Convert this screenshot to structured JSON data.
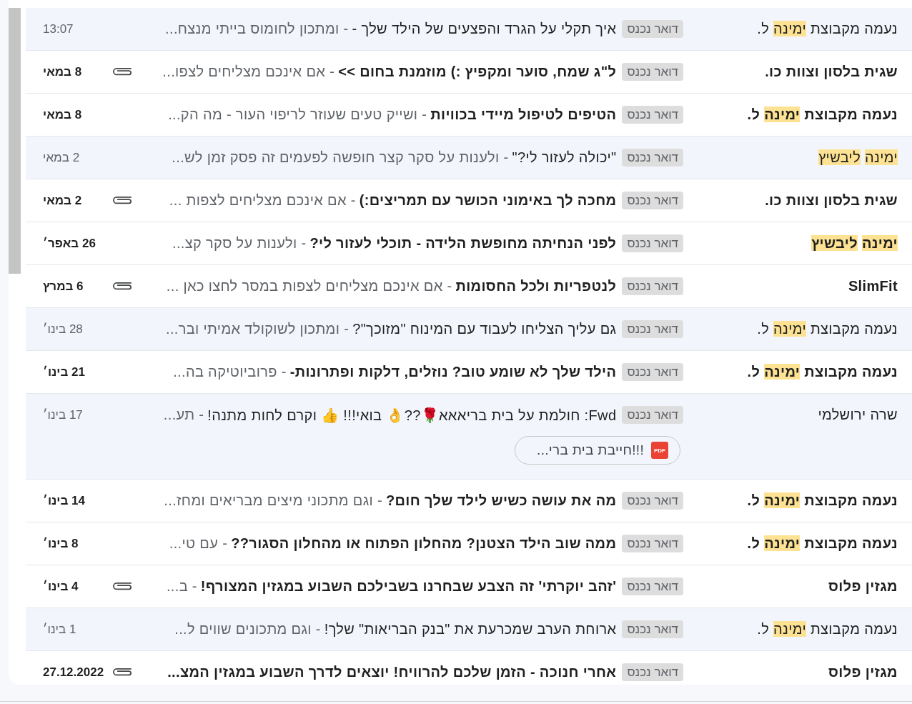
{
  "emails": [
    {
      "unread": false,
      "sender": [
        {
          "word": "נעמה",
          "highlighted": false
        },
        {
          "word": "מקבוצת",
          "highlighted": false
        },
        {
          "word": "ימינה",
          "highlighted": true
        },
        {
          "word": "ל.",
          "highlighted": false
        }
      ],
      "label": "דואר נכנס",
      "subject": "איך תקלי על הגרד והפצעים של הילד שלך -",
      "snippet": "- ומתכון לחומוס בייתי מנצח...",
      "attachment": false,
      "date": "13:07"
    },
    {
      "unread": true,
      "sender": [
        {
          "word": "שגית",
          "highlighted": false
        },
        {
          "word": "בלסון",
          "highlighted": false
        },
        {
          "word": "וצוות",
          "highlighted": false
        },
        {
          "word": "כו.",
          "highlighted": false
        }
      ],
      "label": "דואר נכנס",
      "subject": "ל\"ג שמח, סוער ומקפיץ :) מוזמנת בחום >>",
      "snippet": "- אם אינכם מצליחים לצפו...",
      "attachment": true,
      "date": "8 במאי"
    },
    {
      "unread": true,
      "sender": [
        {
          "word": "נעמה",
          "highlighted": false
        },
        {
          "word": "מקבוצת",
          "highlighted": false
        },
        {
          "word": "ימינה",
          "highlighted": true
        },
        {
          "word": "ל.",
          "highlighted": false
        }
      ],
      "label": "דואר נכנס",
      "subject": "הטיפים לטיפול מיידי בכוויות",
      "snippet": "- ושייק טעים שעוזר לריפוי העור - מה הק...",
      "attachment": false,
      "date": "8 במאי"
    },
    {
      "unread": false,
      "sender": [
        {
          "word": "ימינה",
          "highlighted": true
        },
        {
          "word": "ליבשיץ",
          "highlighted": true
        }
      ],
      "label": "דואר נכנס",
      "subject": "\"יכולה לעזור לי?\"",
      "snippet": "- ולענות על סקר קצר חופשה לפעמים זה פסק זמן לש...",
      "attachment": false,
      "date": "2 במאי"
    },
    {
      "unread": true,
      "sender": [
        {
          "word": "שגית",
          "highlighted": false
        },
        {
          "word": "בלסון",
          "highlighted": false
        },
        {
          "word": "וצוות",
          "highlighted": false
        },
        {
          "word": "כו.",
          "highlighted": false
        }
      ],
      "label": "דואר נכנס",
      "subject": "מחכה לך באימוני הכושר עם תמריצים:)",
      "snippet": "- אם אינכם מצליחים לצפות ...",
      "attachment": true,
      "date": "2 במאי"
    },
    {
      "unread": true,
      "sender": [
        {
          "word": "ימינה",
          "highlighted": true
        },
        {
          "word": "ליבשיץ",
          "highlighted": true
        }
      ],
      "label": "דואר נכנס",
      "subject": "לפני הנחיתה מחופשת הלידה - תוכלי לעזור לי?",
      "snippet": "- ולענות על סקר קצ...",
      "attachment": false,
      "date": "26 באפר׳"
    },
    {
      "unread": true,
      "sender": [
        {
          "word": "SlimFit",
          "highlighted": false
        }
      ],
      "label": "דואר נכנס",
      "subject": "לנטפריות ולכל החסומות",
      "snippet": "- אם אינכם מצליחים לצפות במסר לחצו כאן ...",
      "attachment": true,
      "date": "6 במרץ"
    },
    {
      "unread": false,
      "sender": [
        {
          "word": "נעמה",
          "highlighted": false
        },
        {
          "word": "מקבוצת",
          "highlighted": false
        },
        {
          "word": "ימינה",
          "highlighted": true
        },
        {
          "word": "ל.",
          "highlighted": false
        }
      ],
      "label": "דואר נכנס",
      "subject": "גם עליך הצליחו לעבוד עם המינוח \"מזוכך\"?",
      "snippet": "- ומתכון לשוקולד אמיתי ובר...",
      "attachment": false,
      "date": "28 בינו׳"
    },
    {
      "unread": true,
      "sender": [
        {
          "word": "נעמה",
          "highlighted": false
        },
        {
          "word": "מקבוצת",
          "highlighted": false
        },
        {
          "word": "ימינה",
          "highlighted": true
        },
        {
          "word": "ל.",
          "highlighted": false
        }
      ],
      "label": "דואר נכנס",
      "subject": "הילד שלך לא שומע טוב? נוזלים, דלקות ופתרונות-",
      "snippet": "- פרוביוטיקה בה...",
      "attachment": false,
      "date": "21 בינו׳"
    },
    {
      "unread": false,
      "sender": [
        {
          "word": "שרה",
          "highlighted": false
        },
        {
          "word": "ירושלמי",
          "highlighted": false
        }
      ],
      "label": "דואר נכנס",
      "subject": "Fwd: חולמת על בית בריאאא🌹??👌 בואי!!! 👍 וקרם לחות מתנה!",
      "snippet": "- תע...",
      "attachment": false,
      "files": [
        {
          "type": "PDF",
          "name": "!!!חייבת בית ברי..."
        }
      ],
      "date": "17 בינו׳"
    },
    {
      "unread": true,
      "sender": [
        {
          "word": "נעמה",
          "highlighted": false
        },
        {
          "word": "מקבוצת",
          "highlighted": false
        },
        {
          "word": "ימינה",
          "highlighted": true
        },
        {
          "word": "ל.",
          "highlighted": false
        }
      ],
      "label": "דואר נכנס",
      "subject": "מה את עושה כשיש לילד שלך חום?",
      "snippet": "- וגם מתכוני מיצים מבריאים ומחז...",
      "attachment": false,
      "date": "14 בינו׳"
    },
    {
      "unread": true,
      "sender": [
        {
          "word": "נעמה",
          "highlighted": false
        },
        {
          "word": "מקבוצת",
          "highlighted": false
        },
        {
          "word": "ימינה",
          "highlighted": true
        },
        {
          "word": "ל.",
          "highlighted": false
        }
      ],
      "label": "דואר נכנס",
      "subject": "ממה שוב הילד הצטנן? מהחלון הפתוח או מהחלון הסגור??",
      "snippet": "- עם טי...",
      "attachment": false,
      "date": "8 בינו׳"
    },
    {
      "unread": true,
      "sender": [
        {
          "word": "מגזין",
          "highlighted": false
        },
        {
          "word": "פלוס",
          "highlighted": false
        }
      ],
      "label": "דואר נכנס",
      "subject": "'זהב יוקרתי' זה הצבע שבחרנו בשבילכם השבוע במגזין המצורף!",
      "snippet": "- ב...",
      "attachment": true,
      "date": "4 בינו׳"
    },
    {
      "unread": false,
      "sender": [
        {
          "word": "נעמה",
          "highlighted": false
        },
        {
          "word": "מקבוצת",
          "highlighted": false
        },
        {
          "word": "ימינה",
          "highlighted": true
        },
        {
          "word": "ל.",
          "highlighted": false
        }
      ],
      "label": "דואר נכנס",
      "subject": "ארוחת הערב שמכרעת את \"בנק הבריאות\" שלך!",
      "snippet": "- וגם מתכונים שווים ל...",
      "attachment": false,
      "date": "1 בינו׳"
    },
    {
      "unread": true,
      "sender": [
        {
          "word": "מגזין",
          "highlighted": false
        },
        {
          "word": "פלוס",
          "highlighted": false
        }
      ],
      "label": "דואר נכנס",
      "subject": "אחרי חנוכה - הזמן שלכם להרוויח! יוצאים לדרך השבוע במגזין המצ...",
      "attachment": true,
      "date": "27.12.2022"
    }
  ]
}
